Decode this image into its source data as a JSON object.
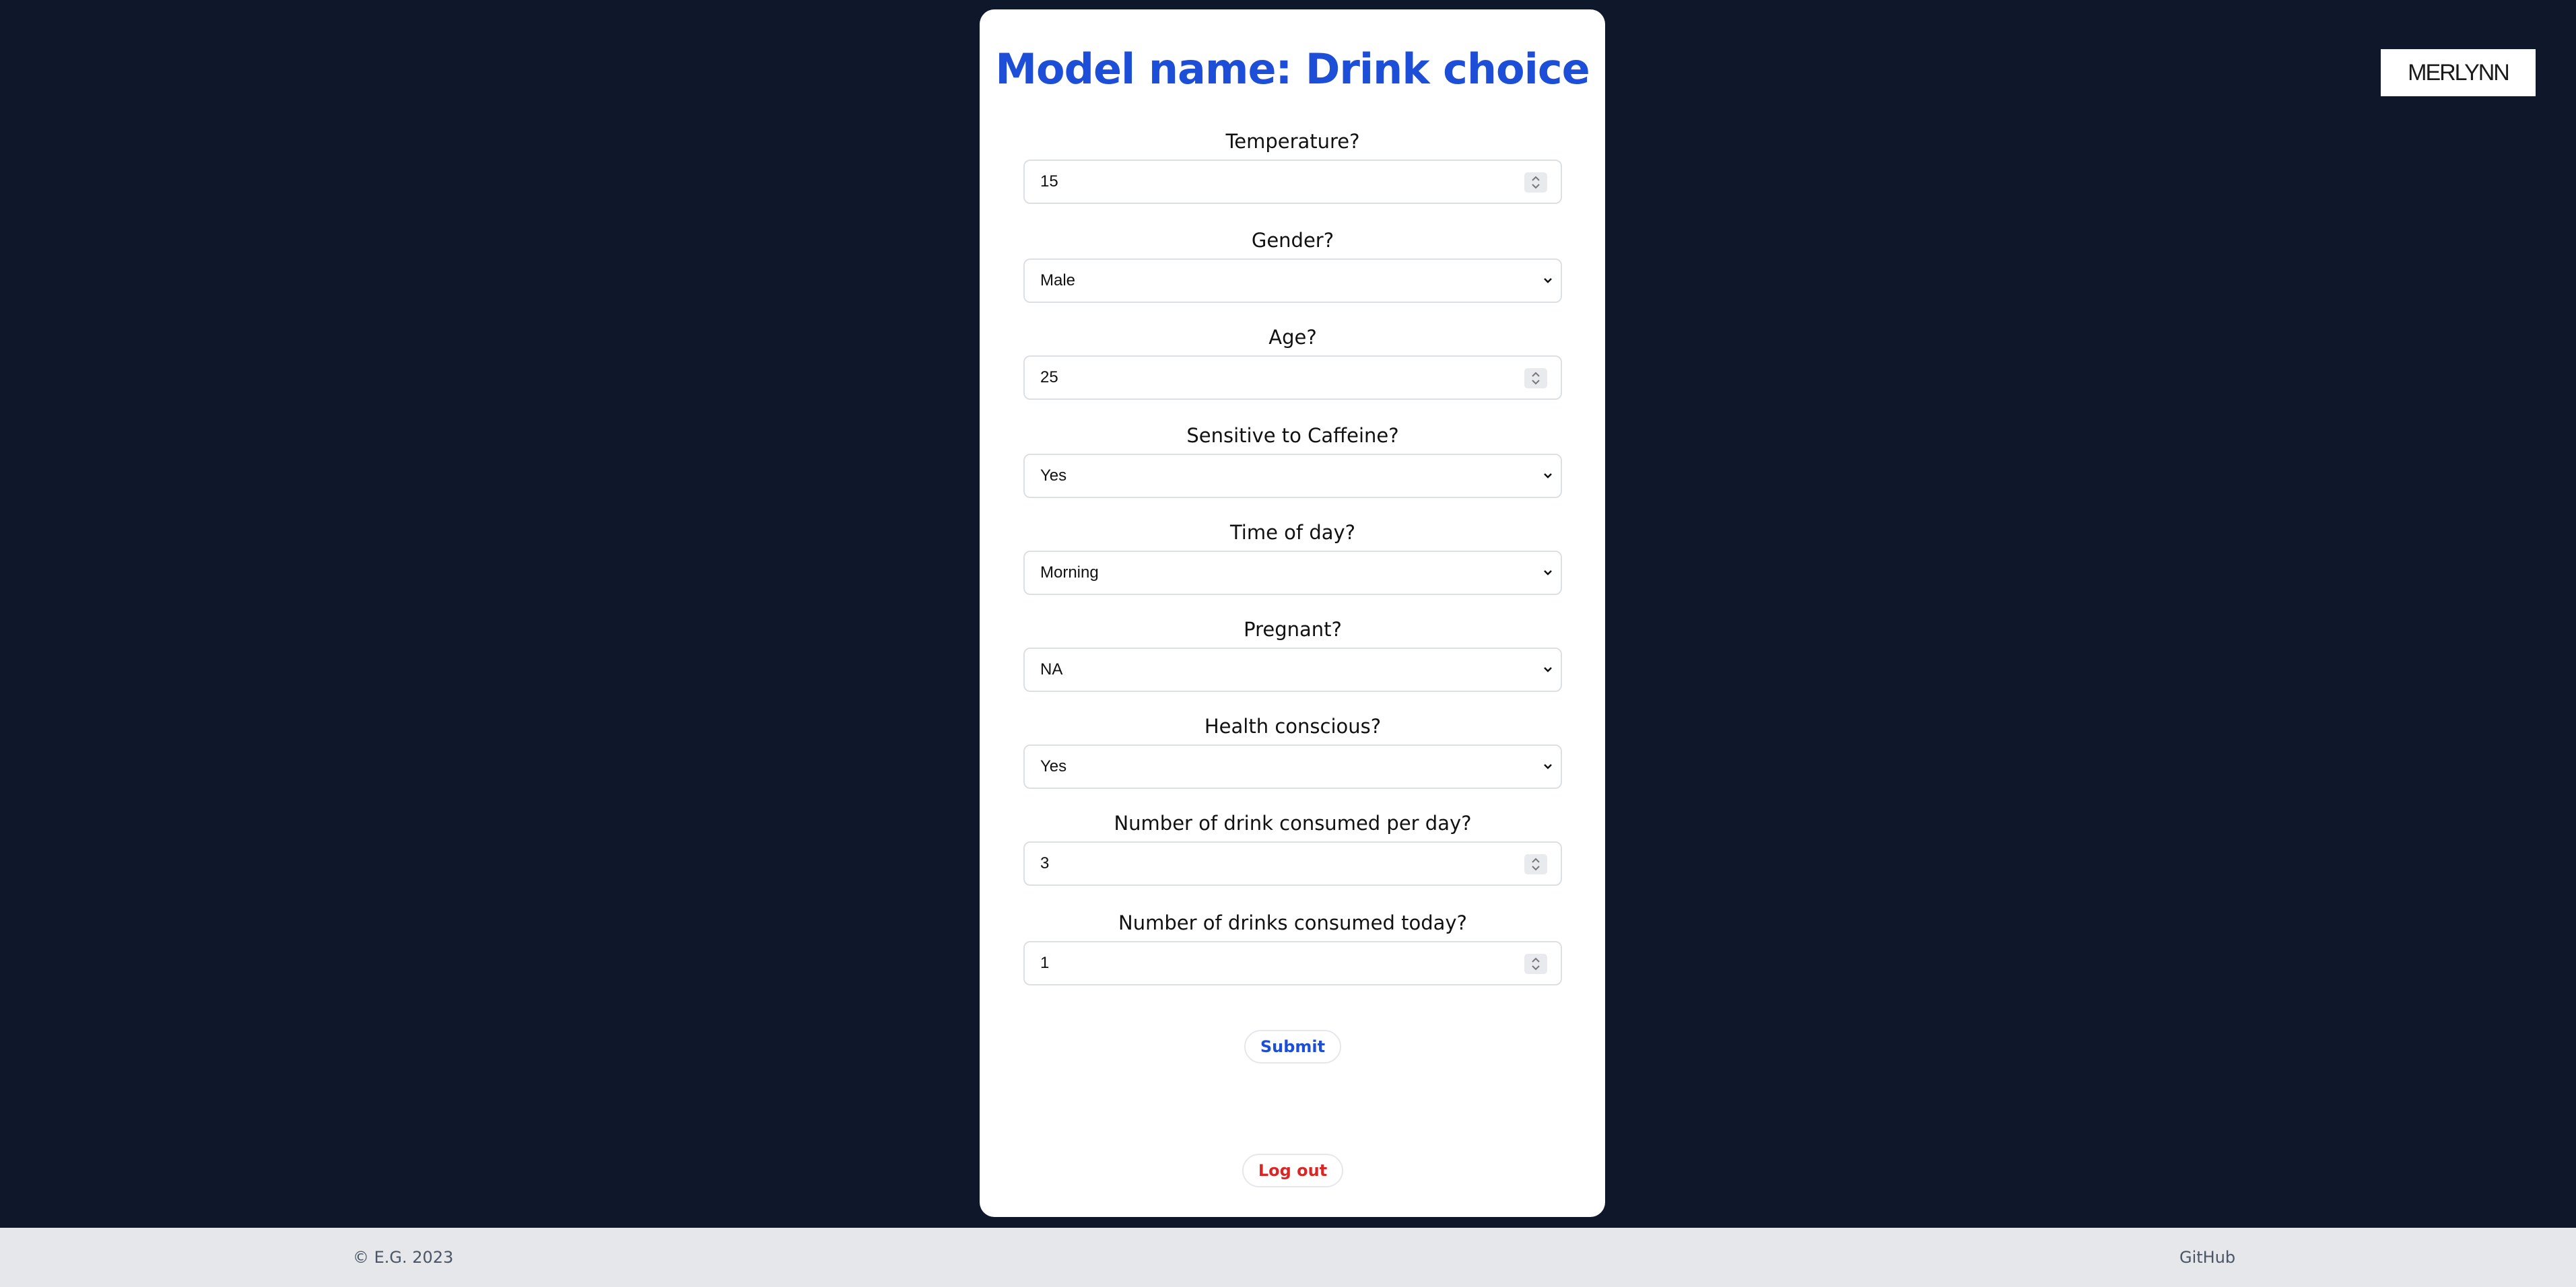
{
  "logo": {
    "text": "MERLYNN"
  },
  "form": {
    "title": "Model name: Drink choice",
    "fields": [
      {
        "label": "Temperature?",
        "value": "15",
        "kind": "number"
      },
      {
        "label": "Gender?",
        "value": "Male",
        "kind": "select"
      },
      {
        "label": "Age?",
        "value": "25",
        "kind": "number"
      },
      {
        "label": "Sensitive to Caffeine?",
        "value": "Yes",
        "kind": "select"
      },
      {
        "label": "Time of day?",
        "value": "Morning",
        "kind": "select"
      },
      {
        "label": "Pregnant?",
        "value": "NA",
        "kind": "select"
      },
      {
        "label": "Health conscious?",
        "value": "Yes",
        "kind": "select"
      },
      {
        "label": "Number of drink consumed per day?",
        "value": "3",
        "kind": "number"
      },
      {
        "label": "Number of drinks consumed today?",
        "value": "1",
        "kind": "number"
      }
    ],
    "submit_label": "Submit",
    "logout_label": "Log out"
  },
  "footer": {
    "copyright": "© E.G. 2023",
    "link": "GitHub"
  },
  "colors": {
    "page_background": "#0f172a",
    "title": "#1d4ed8",
    "submit": "#1d4ed8",
    "logout": "#dc2626",
    "footer_background": "#e5e7eb"
  }
}
